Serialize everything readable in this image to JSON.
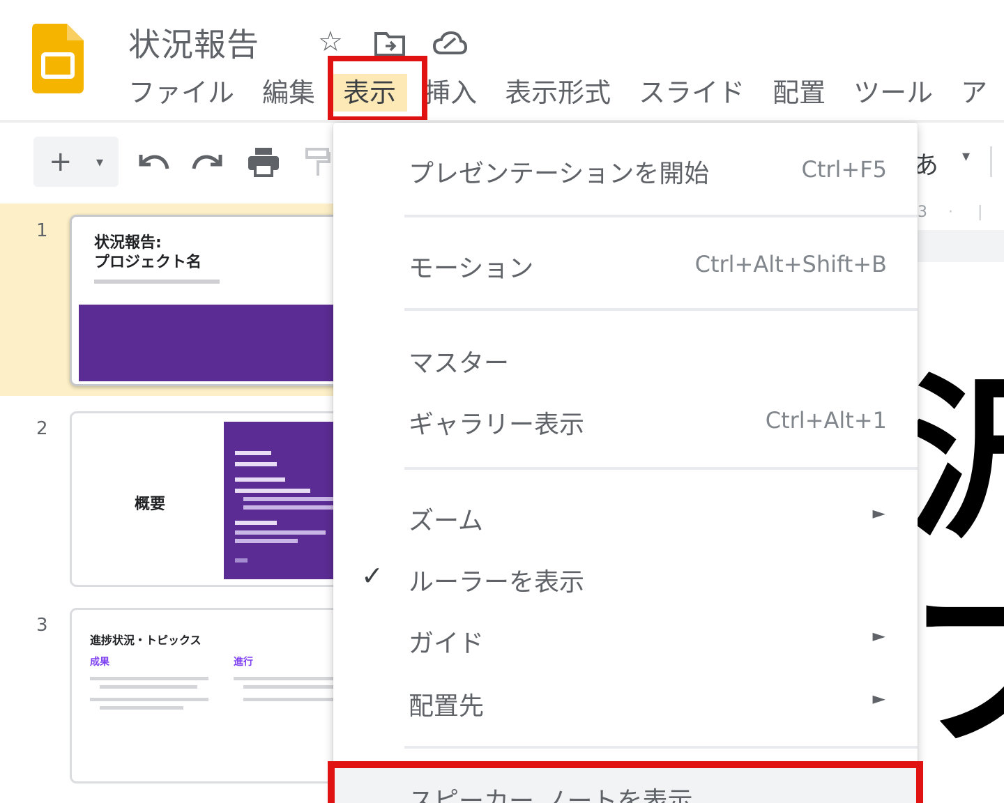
{
  "app": {
    "doc_title": "状況報告",
    "colors": {
      "brand": "#f4b400",
      "highlight_box": "#e01212",
      "active_menu_bg": "#fde9b6",
      "slide_purple": "#5b2c94"
    }
  },
  "title_icons": [
    "star-icon",
    "move-to-folder-icon",
    "cloud-status-icon"
  ],
  "menubar": {
    "items": [
      "ファイル",
      "編集",
      "表示",
      "挿入",
      "表示形式",
      "スライド",
      "配置",
      "ツール",
      "ア"
    ],
    "active": "表示"
  },
  "toolbar": {
    "add_glyph": "+",
    "right_text": "あ",
    "icons": [
      "add-icon",
      "dropdown-caret-icon",
      "undo-icon",
      "redo-icon",
      "print-icon",
      "paint-format-icon"
    ]
  },
  "filmstrip": {
    "slides": [
      {
        "number": "1",
        "title": "状況報告:\nプロジェクト名",
        "selected": true
      },
      {
        "number": "2",
        "label": "概要",
        "selected": false
      },
      {
        "number": "3",
        "title": "進捗状況・トピックス",
        "col1": "成果",
        "col2": "進行",
        "selected": false
      }
    ]
  },
  "ruler": {
    "marker": "3"
  },
  "slide_canvas": {
    "line1": "沢",
    "line2": "プロ"
  },
  "view_menu": {
    "items": [
      {
        "label": "プレゼンテーションを開始",
        "shortcut": "Ctrl+F5"
      },
      {
        "label": "モーション",
        "shortcut": "Ctrl+Alt+Shift+B"
      },
      {
        "label": "マスター",
        "shortcut": ""
      },
      {
        "label": "ギャラリー表示",
        "shortcut": "Ctrl+Alt+1"
      },
      {
        "label": "ズーム",
        "submenu": true
      },
      {
        "label": "ルーラーを表示",
        "checked": true
      },
      {
        "label": "ガイド",
        "submenu": true
      },
      {
        "label": "配置先",
        "submenu": true
      },
      {
        "label": "スピーカー ノートを表示",
        "highlighted": true
      }
    ],
    "check_glyph": "✓",
    "submenu_glyph": "►"
  }
}
